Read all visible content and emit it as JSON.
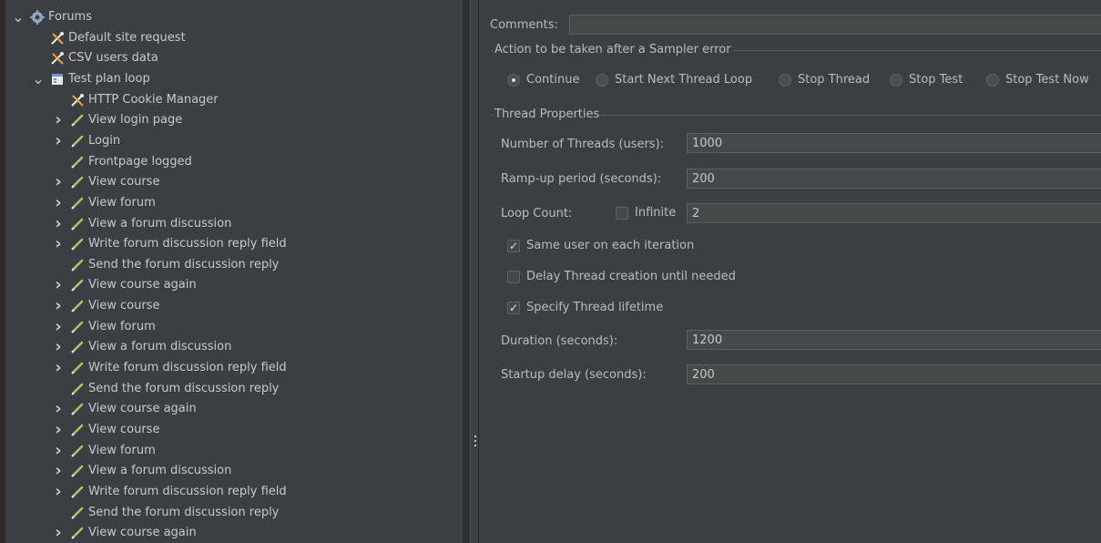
{
  "tree": {
    "items": [
      {
        "label": "Forums",
        "icon": "gear-icon",
        "expanded": true,
        "has_children": true
      },
      {
        "label": "Default site request",
        "icon": "tools-icon",
        "has_children": false
      },
      {
        "label": "CSV users data",
        "icon": "tools-icon",
        "has_children": false
      },
      {
        "label": "Test plan loop",
        "icon": "thread-group-icon",
        "expanded": true,
        "has_children": true
      },
      {
        "label": "HTTP Cookie Manager",
        "icon": "tools-icon",
        "has_children": false
      },
      {
        "label": "View login page",
        "icon": "sampler-pipette-icon",
        "has_children": true
      },
      {
        "label": "Login",
        "icon": "sampler-pipette-icon",
        "has_children": true
      },
      {
        "label": "Frontpage logged",
        "icon": "sampler-pipette-icon",
        "has_children": false
      },
      {
        "label": "View course",
        "icon": "sampler-pipette-icon",
        "has_children": true
      },
      {
        "label": "View forum",
        "icon": "sampler-pipette-icon",
        "has_children": true
      },
      {
        "label": "View a forum discussion",
        "icon": "sampler-pipette-icon",
        "has_children": true
      },
      {
        "label": "Write forum discussion reply field",
        "icon": "sampler-pipette-icon",
        "has_children": true
      },
      {
        "label": "Send the forum discussion reply",
        "icon": "sampler-pipette-icon",
        "has_children": false
      },
      {
        "label": "View course again",
        "icon": "sampler-pipette-icon",
        "has_children": true
      },
      {
        "label": "View course",
        "icon": "sampler-pipette-icon",
        "has_children": true
      },
      {
        "label": "View forum",
        "icon": "sampler-pipette-icon",
        "has_children": true
      },
      {
        "label": "View a forum discussion",
        "icon": "sampler-pipette-icon",
        "has_children": true
      },
      {
        "label": "Write forum discussion reply field",
        "icon": "sampler-pipette-icon",
        "has_children": true
      },
      {
        "label": "Send the forum discussion reply",
        "icon": "sampler-pipette-icon",
        "has_children": false
      },
      {
        "label": "View course again",
        "icon": "sampler-pipette-icon",
        "has_children": true
      },
      {
        "label": "View course",
        "icon": "sampler-pipette-icon",
        "has_children": true
      },
      {
        "label": "View forum",
        "icon": "sampler-pipette-icon",
        "has_children": true
      },
      {
        "label": "View a forum discussion",
        "icon": "sampler-pipette-icon",
        "has_children": true
      },
      {
        "label": "Write forum discussion reply field",
        "icon": "sampler-pipette-icon",
        "has_children": true
      },
      {
        "label": "Send the forum discussion reply",
        "icon": "sampler-pipette-icon",
        "has_children": false
      },
      {
        "label": "View course again",
        "icon": "sampler-pipette-icon",
        "has_children": true
      }
    ]
  },
  "config": {
    "comments_label": "Comments:",
    "comments_value": "",
    "sampler_error": {
      "title": "Action to be taken after a Sampler error",
      "options": [
        "Continue",
        "Start Next Thread Loop",
        "Stop Thread",
        "Stop Test",
        "Stop Test Now"
      ],
      "selected": "Continue"
    },
    "thread_props": {
      "title": "Thread Properties",
      "threads_label": "Number of Threads (users):",
      "threads_value": "1000",
      "rampup_label": "Ramp-up period (seconds):",
      "rampup_value": "200",
      "loop_label": "Loop Count:",
      "infinite_label": "Infinite",
      "infinite_checked": false,
      "loop_value": "2",
      "same_user_label": "Same user on each iteration",
      "same_user_checked": true,
      "delay_label": "Delay Thread creation until needed",
      "delay_checked": false,
      "lifetime_label": "Specify Thread lifetime",
      "lifetime_checked": true,
      "duration_label": "Duration (seconds):",
      "duration_value": "1200",
      "startup_label": "Startup delay (seconds):",
      "startup_value": "200"
    }
  }
}
